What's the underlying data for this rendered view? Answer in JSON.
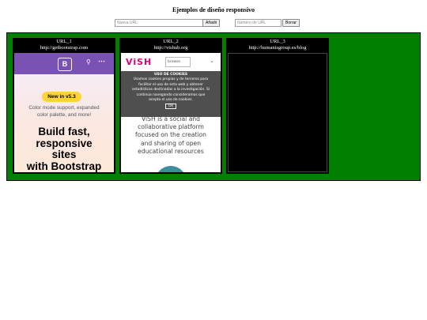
{
  "page": {
    "title": "Ejemplos de diseño responsivo"
  },
  "controls": {
    "url_placeholder": "Nueva URL",
    "add_label": "Añadir",
    "number_placeholder": "Número de URL",
    "delete_label": "Borrar"
  },
  "stage_color": "#008000",
  "frames": [
    {
      "label": "URL_1",
      "url": "http://getbootstrap.com",
      "content": {
        "logo": "B",
        "badge": "New in v5.3",
        "subtitle": "Color mode support, expanded color palette, and more!",
        "headline": "Build fast, responsive sites with Bootstrap",
        "headline_lines": [
          "Build fast,",
          "responsive",
          "sites",
          "with Bootstrap"
        ],
        "subtitle_lines": [
          "Color mode support, expanded",
          "color palette, and more!"
        ],
        "icons": [
          "search-icon",
          "more-icon"
        ]
      }
    },
    {
      "label": "URL_2",
      "url": "http://vishub.org",
      "content": {
        "logo": "ViSH",
        "browse": "browse",
        "cookie_title": "USO DE COOKIES",
        "cookie_lines": [
          "Usamos cookies propias y de terceros para",
          "facilitar el uso de esta web y obtener",
          "estadísticas destinadas a la investigación. Si",
          "continúa navegando consideramos que",
          "acepta el uso de cookies."
        ],
        "ok": "Ok",
        "text_lines": [
          "ViSH is a social and",
          "collaborative platform",
          "focused on the creation",
          "and sharing of open",
          "educational resources"
        ]
      }
    },
    {
      "label": "URL_3",
      "url": "http://humanisgroup.es/blog",
      "content": {}
    }
  ]
}
